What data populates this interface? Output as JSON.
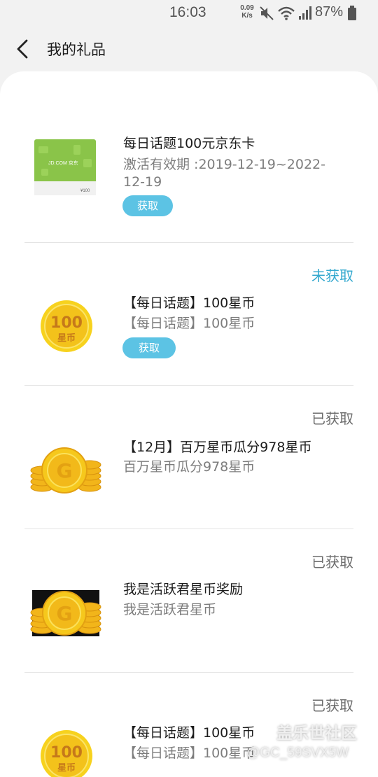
{
  "status_bar": {
    "time": "16:03",
    "net_speed_value": "0.09",
    "net_speed_unit": "K/s",
    "battery": "87%",
    "icons": [
      "mute-icon",
      "wifi-icon",
      "signal-icon",
      "battery-icon"
    ]
  },
  "header": {
    "title": "我的礼品",
    "back_icon": "chevron-left-icon"
  },
  "gifts": [
    {
      "image": "jd-gift-card",
      "card_brand": "JD.COM 京东",
      "card_value": "¥100",
      "status": "",
      "title": "每日话题100元京东卡",
      "description": "激活有效期 :2019-12-19~2022-12-19",
      "button": "获取"
    },
    {
      "image": "100-coin",
      "coin_value": "100",
      "coin_unit": "星币",
      "status": "未获取",
      "title": "【每日话题】100星币",
      "description": "【每日话题】100星币",
      "button": "获取"
    },
    {
      "image": "gold-coins",
      "coin_letter": "G",
      "status": "已获取",
      "title": "【12月】百万星币瓜分978星币",
      "description": "百万星币瓜分978星币",
      "button": ""
    },
    {
      "image": "gold-coins",
      "coin_letter": "G",
      "status": "已获取",
      "title": "我是活跃君星币奖励",
      "description": "我是活跃君星币",
      "button": ""
    },
    {
      "image": "100-coin",
      "coin_value": "100",
      "coin_unit": "星币",
      "status": "已获取",
      "title": "【每日话题】100星币",
      "description": "【每日话题】100星币",
      "button": ""
    }
  ],
  "watermark": {
    "brand": "盖乐世社区",
    "user": "@GC_59SVX5W"
  },
  "colors": {
    "accent": "#5cc3e4",
    "pending_status": "#35a9cf",
    "background": "#f2f2f2",
    "coin_gold": "#f3c21b"
  }
}
